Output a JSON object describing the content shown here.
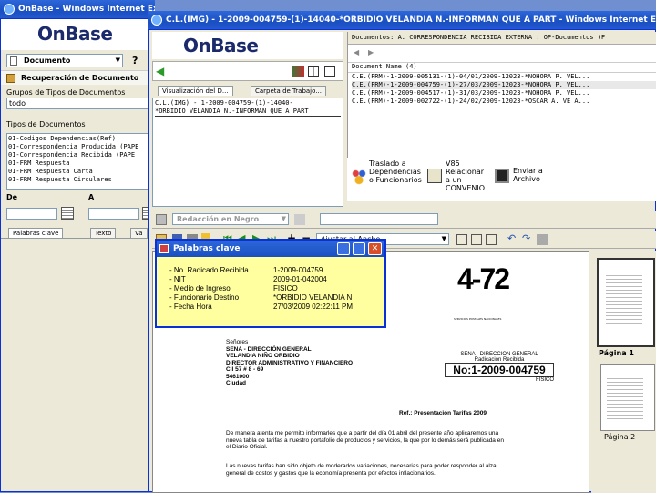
{
  "bg_window": {
    "title": "OnBase - Windows Internet Exp"
  },
  "fg_window": {
    "title": "C.L.(IMG) - 1-2009-004759-(1)-14040-*ORBIDIO VELANDIA N.-INFORMAN QUE A PART - Windows Internet Expl..."
  },
  "left_panel": {
    "logo": "OnBase",
    "dropdown_value": "Documento",
    "section_title": "Recuperación de Documento",
    "group_label": "Grupos de Tipos de Documentos",
    "group_value": "todo",
    "types_label": "Tipos de Documentos",
    "types": [
      "01-Codigos Dependencias(Ref)",
      "01-Correspondencia Producida (PAPE",
      "01-Correspondencia Recibida (PAPE",
      "01-FRM Respuesta",
      "01-FRM Respuesta Carta",
      "01-FRM Respuesta Circulares"
    ],
    "from_label": "De",
    "to_label": "A",
    "tabs": [
      "Palabras clave",
      "Texto",
      "Va"
    ]
  },
  "viewer": {
    "logo": "OnBase",
    "tabs": [
      "Visualización del D...",
      "Carpeta de Trabajo..."
    ],
    "doc_line1": "C.L.(IMG) - 1-2009-004759-(1)-14040-",
    "doc_line2": "*ORBIDIO VELANDIA N.-INFORMAN QUE A PART",
    "redaction_value": "Redacción en Negro",
    "fit_value": "Ajustar al Ancho"
  },
  "results": {
    "path": "Documentos: A. CORRESPONDENCIA RECIBIDA EXTERNA : OP-Documentos (F",
    "column_header": "Document Name (4)",
    "rows": [
      "C.E.(FRM)-1-2009-005131-(1)-04/01/2009-12023-*NOHORA P. VEL...",
      "C.E.(FRM)-1-2009-004759-(1)-27/03/2009-12023-*NOHORA P. VEL...",
      "C.E.(FRM)-1-2009-004517-(1)-31/03/2009-12023-*NOHORA P. VEL...",
      "C.E.(FRM)-1-2009-002722-(1)-24/02/2009-12023-*OSCAR A. VE A..."
    ],
    "selected_row": 1,
    "actions": [
      {
        "label": "Traslado a Dependencias o Funcionarios",
        "icon": "people-icon"
      },
      {
        "label": "V85 Relacionar a un CONVENIO",
        "icon": "book-icon"
      },
      {
        "label": "Enviar a Archivo",
        "icon": "cabinet-icon"
      }
    ]
  },
  "popup": {
    "title": "Palabras clave",
    "rows": [
      {
        "key": "- No. Radicado Recibida",
        "value": "1-2009-004759"
      },
      {
        "key": "- NIT",
        "value": "2009-01-042004"
      },
      {
        "key": "- Medio de Ingreso",
        "value": "FISICO"
      },
      {
        "key": "- Funcionario Destino",
        "value": "*ORBIDIO VELANDIA N"
      },
      {
        "key": "- Fecha Hora",
        "value": "27/03/2009 02:22:11 PM"
      }
    ]
  },
  "letter": {
    "logo_text": "4-72",
    "logo_sub": "SERVICIOS POSTALES NACIONALES",
    "addressee": [
      "Señores",
      "SENA - DIRECCIÓN GENERAL",
      "VELANDIA NIÑO ORBIDIO",
      "DIRECTOR ADMINISTRATIVO Y FINANCIERO",
      "Cll 57 # 8 - 69",
      "5461000",
      "Ciudad"
    ],
    "stamp_line1": "SENA - DIRECCION GENERAL",
    "stamp_line2": "Radicación Recibida",
    "stamp_number": "No:1-2009-004759",
    "stamp_line3": "FISICO",
    "ref": "Ref.: Presentación Tarifas 2009",
    "para1": "De manera atenta me permito informarles que a partir del día 01 abril del presente año aplicaremos una nueva tabla de tarifas a nuestro portafolio de productos y servicios, la que por lo demás será publicada en el Diario Oficial.",
    "para2": "Las nuevas tarifas han sido objeto de moderados variaciones, necesarias para poder responder al alza general de costos y gastos que la economía presenta por efectos inflacionarios."
  },
  "thumbnails": {
    "page1": "Página 1",
    "page2": "Página 2"
  }
}
